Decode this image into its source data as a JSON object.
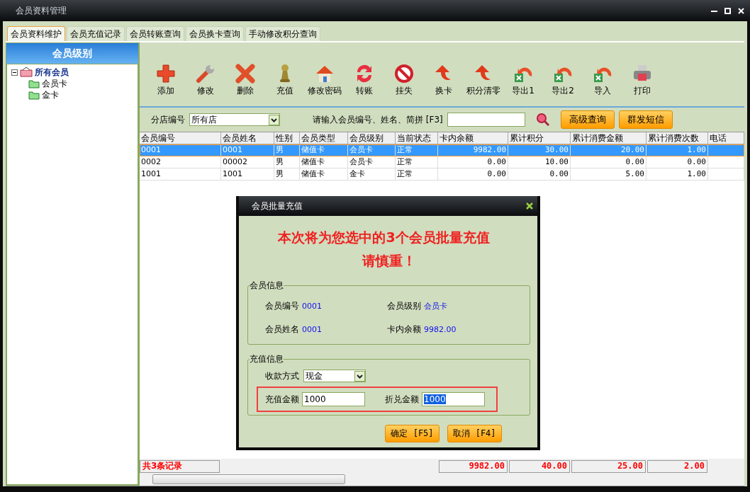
{
  "window": {
    "title": "会员资料管理"
  },
  "tabs": [
    {
      "label": "会员资料维护",
      "selected": true
    },
    {
      "label": "会员充值记录",
      "selected": false
    },
    {
      "label": "会员转账查询",
      "selected": false
    },
    {
      "label": "会员换卡查询",
      "selected": false
    },
    {
      "label": "手动修改积分查询",
      "selected": false
    }
  ],
  "sidebar": {
    "title": "会员级别",
    "tree": [
      {
        "label": "所有会员",
        "expanded": true,
        "children": [
          {
            "label": "会员卡"
          },
          {
            "label": "金卡"
          }
        ]
      }
    ]
  },
  "toolbar": [
    {
      "kind": "add",
      "label": "添加"
    },
    {
      "kind": "edit",
      "label": "修改"
    },
    {
      "kind": "delete",
      "label": "删除"
    },
    {
      "kind": "recharge",
      "label": "充值"
    },
    {
      "kind": "password",
      "label": "修改密码"
    },
    {
      "kind": "transfer",
      "label": "转账"
    },
    {
      "kind": "lost",
      "label": "挂失"
    },
    {
      "kind": "swap",
      "label": "换卡"
    },
    {
      "kind": "swap",
      "label": "积分清零"
    },
    {
      "kind": "export",
      "label": "导出1"
    },
    {
      "kind": "export",
      "label": "导出2"
    },
    {
      "kind": "export",
      "label": "导入"
    },
    {
      "kind": "print",
      "label": "打印"
    }
  ],
  "filter": {
    "store_label": "分店编号",
    "store_value": "所有店",
    "search_label": "请输入会员编号、姓名、简拼 [F3]",
    "buttons": [
      "高级查询",
      "群发短信"
    ]
  },
  "table": {
    "columns": [
      "会员编号",
      "会员姓名",
      "性别",
      "会员类型",
      "会员级别",
      "当前状态",
      "卡内余额",
      "累计积分",
      "累计消费金额",
      "累计消费次数",
      "电话"
    ],
    "rows": [
      {
        "selected": true,
        "cells": [
          "0001",
          "0001",
          "男",
          "储值卡",
          "会员卡",
          "正常",
          "9982.00",
          "30.00",
          "20.00",
          "1.00"
        ]
      },
      {
        "selected": false,
        "cells": [
          "0002",
          "00002",
          "男",
          "储值卡",
          "会员卡",
          "正常",
          "0.00",
          "10.00",
          "0.00",
          "0.00"
        ]
      },
      {
        "selected": false,
        "cells": [
          "1001",
          "1001",
          "男",
          "储值卡",
          "金卡",
          "正常",
          "0.00",
          "0.00",
          "5.00",
          "1.00"
        ]
      }
    ]
  },
  "summary": {
    "record_count": "共3条记录",
    "totals": [
      "9982.00",
      "40.00",
      "25.00",
      "2.00"
    ]
  },
  "dialog": {
    "title": "会员批量充值",
    "headline": [
      "本次将为您选中的3个会员批量充值",
      "请慎重！"
    ],
    "member_info": {
      "legend": "会员信息",
      "fields": [
        {
          "label": "会员编号",
          "value": "0001"
        },
        {
          "label": "会员级别",
          "value": "会员卡"
        },
        {
          "label": "会员姓名",
          "value": "0001"
        },
        {
          "label": "卡内余额",
          "value": "9982.00"
        }
      ]
    },
    "recharge_info": {
      "legend": "充值信息",
      "payment": {
        "label": "收款方式",
        "value": "现金"
      },
      "amount": {
        "label": "充值金额",
        "value": "1000",
        "selected": false
      },
      "converted": {
        "label": "折兑金额",
        "value": "1000",
        "selected": true
      }
    },
    "buttons": [
      "确定 [F5]",
      "取消 [F4]"
    ]
  }
}
